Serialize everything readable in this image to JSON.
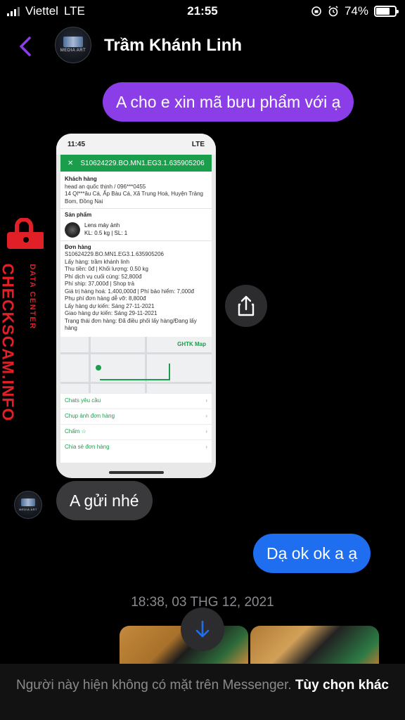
{
  "status_bar": {
    "carrier": "Viettel",
    "network": "LTE",
    "time": "21:55",
    "battery": "74%",
    "battery_level": 0.74
  },
  "header": {
    "contact_name": "Trầm Khánh Linh",
    "avatar_text": "MEDIA ART"
  },
  "messages": {
    "sent_1": "A cho e xin mã bưu phẩm với ạ",
    "received_1": "A gửi nhé",
    "sent_2": "Dạ ok ok a ạ"
  },
  "screenshot": {
    "time": "11:45",
    "network": "LTE",
    "order_code": "S10624229.BO.MN1.EG3.1.635905206",
    "customer_title": "Khách hàng",
    "customer_line": "head an quốc thịnh / 096***0455",
    "address": "14 Ql***âu Cá, Ấp Bàu Cá, Xã Trung Hoà, Huyện Trảng Bom, Đồng Nai",
    "product_title": "Sản phẩm",
    "product_name": "Lens máy ảnh",
    "product_meta": "KL: 0.5 kg | SL: 1",
    "order_title": "Đơn hàng",
    "order_lines": [
      "S10624229.BO.MN1.EG3.1.635905206",
      "Lấy hàng: trầm khánh linh",
      "Thu tiền: 0đ | Khối lượng: 0.50 kg",
      "Phí dịch vụ cuối cùng: 52,800đ",
      "Phí ship: 37,000đ | Shop trả",
      "Giá trị hàng hoá: 1,400,000đ | Phí bảo hiểm: 7,000đ",
      "Phụ phí đơn hàng dễ vỡ: 8,800đ",
      "Lấy hàng dự kiến: Sáng 27-11-2021",
      "Giao hàng dự kiến: Sáng 29-11-2021",
      "Trạng thái đơn hàng: Đã điều phối lấy hàng/Đang lấy hàng"
    ],
    "map_label": "GHTK Map",
    "menu_items": [
      "Chats yêu cầu",
      "Chụp ảnh đơn hàng",
      "Chấm",
      "Chia sẻ đơn hàng"
    ]
  },
  "watermark": {
    "main": "CHECKSCAM.INFO",
    "sub": "DATA CENTER"
  },
  "timestamp": "18:38, 03 THG 12, 2021",
  "footer": {
    "note": "Người này hiện không có mặt trên Messenger.",
    "link": "Tùy chọn khác"
  },
  "colors": {
    "sent_purple": "#8b3ee8",
    "sent_blue": "#1f6ef0",
    "received_gray": "#3a3a3c",
    "ghtk_green": "#1a9e4b",
    "watermark_red": "#e11f26"
  },
  "icons": [
    "back-chevron-icon",
    "share-icon",
    "arrow-down-icon",
    "lock-icon",
    "alarm-icon",
    "orientation-lock-icon"
  ]
}
